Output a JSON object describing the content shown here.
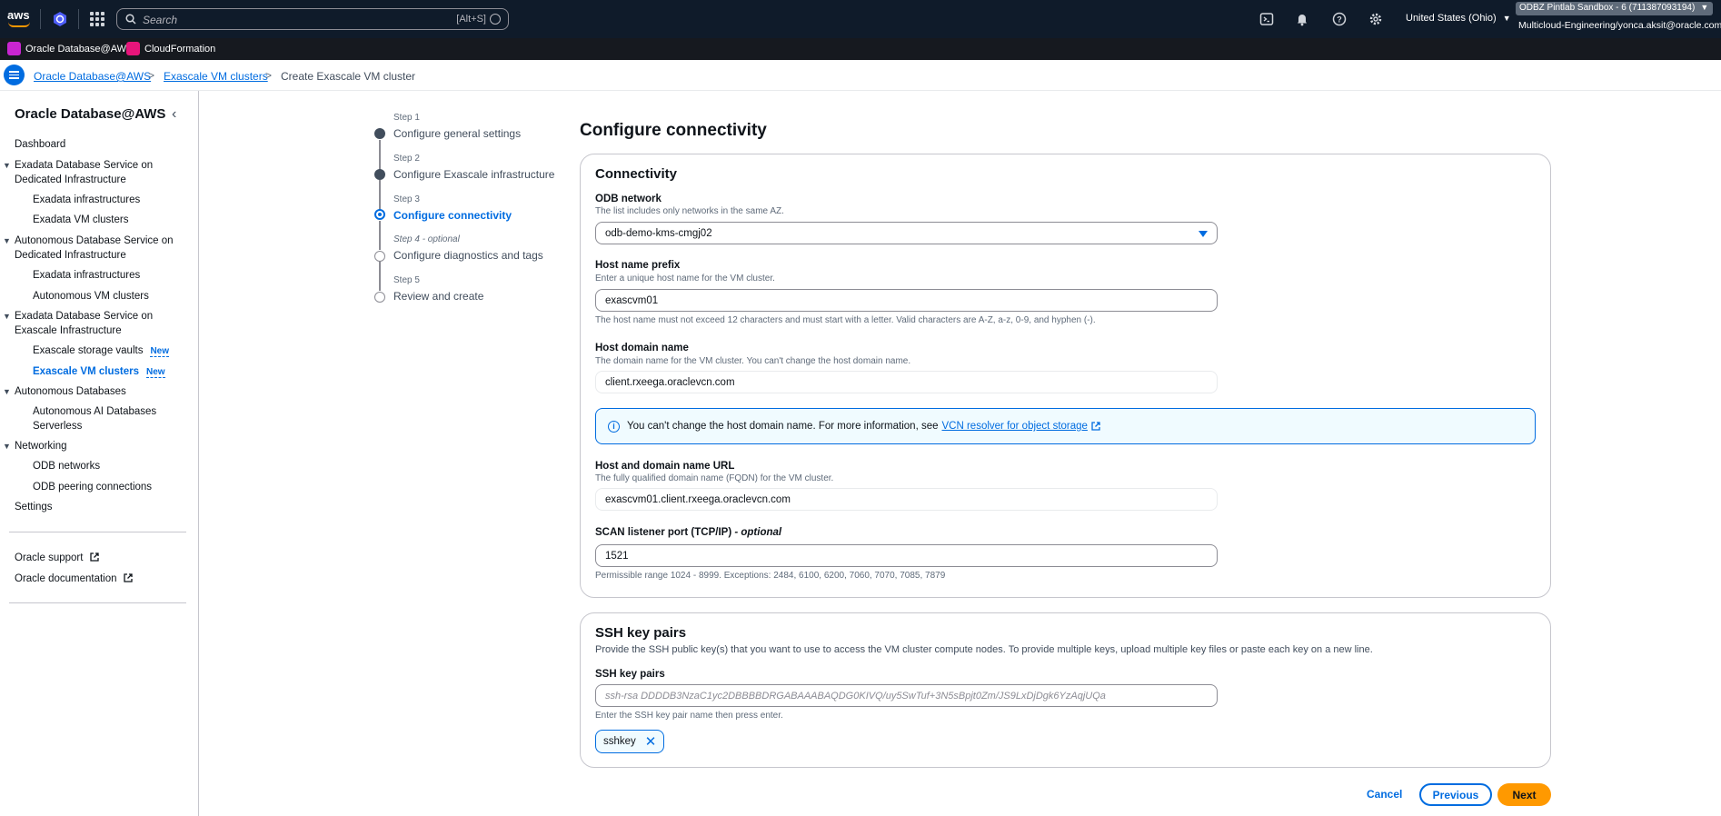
{
  "topnav": {
    "logo_text": "aws",
    "search_placeholder": "Search",
    "search_shortcut": "[Alt+S]",
    "region": "United States (Ohio)",
    "region_caret": "▼",
    "account_name": "ODBZ Pintlab Sandbox - 6 (711387093194)",
    "account_caret": "▼",
    "account_user": "Multicloud-Engineering/yonca.aksit@oracle.com"
  },
  "favorites": [
    {
      "label": "Oracle Database@AWS",
      "color": "#c925d1"
    },
    {
      "label": "CloudFormation",
      "color": "#e7157b"
    }
  ],
  "breadcrumb": {
    "items": [
      "Oracle Database@AWS",
      "Exascale VM clusters"
    ],
    "current": "Create Exascale VM cluster",
    "separator": ">"
  },
  "sidebar": {
    "title": "Oracle Database@AWS",
    "collapse_glyph": "‹",
    "dashboard": "Dashboard",
    "section1": "Exadata Database Service on Dedicated Infrastructure",
    "section1_items": [
      "Exadata infrastructures",
      "Exadata VM clusters"
    ],
    "section2": "Autonomous Database Service on Dedicated Infrastructure",
    "section2_items": [
      "Exadata infrastructures",
      "Autonomous VM clusters"
    ],
    "section3": "Exadata Database Service on Exascale Infrastructure",
    "section3_items": [
      "Exascale storage vaults",
      "Exascale VM clusters"
    ],
    "new_badge": "New",
    "section4": "Autonomous Databases",
    "section4_items": [
      "Autonomous AI Databases Serverless"
    ],
    "section5": "Networking",
    "section5_items": [
      "ODB networks",
      "ODB peering connections"
    ],
    "settings": "Settings",
    "support": "Oracle support",
    "documentation": "Oracle documentation"
  },
  "steps": [
    {
      "number": "Step 1",
      "label": "Configure general settings",
      "state": "done"
    },
    {
      "number": "Step 2",
      "label": "Configure Exascale infrastructure",
      "state": "done"
    },
    {
      "number": "Step 3",
      "label": "Configure connectivity",
      "state": "current"
    },
    {
      "number": "Step 4 - optional",
      "label": "Configure diagnostics and tags",
      "state": "future"
    },
    {
      "number": "Step 5",
      "label": "Review and create",
      "state": "future"
    }
  ],
  "page": {
    "heading": "Configure connectivity"
  },
  "connectivity": {
    "title": "Connectivity",
    "odb_network_label": "ODB network",
    "odb_network_desc": "The list includes only networks in the same AZ.",
    "odb_network_value": "odb-demo-kms-cmgj02",
    "host_prefix_label": "Host name prefix",
    "host_prefix_desc": "Enter a unique host name for the VM cluster.",
    "host_prefix_value": "exascvm01",
    "host_prefix_constraint": "The host name must not exceed 12 characters and must start with a letter. Valid characters are A-Z, a-z, 0-9, and hyphen (-).",
    "domain_label": "Host domain name",
    "domain_desc": "The domain name for the VM cluster. You can't change the host domain name.",
    "domain_value": "client.rxeega.oraclevcn.com",
    "alert_text": "You can't change the host domain name. For more information, see",
    "alert_link": "VCN resolver for object storage",
    "fqdn_label": "Host and domain name URL",
    "fqdn_desc": "The fully qualified domain name (FQDN) for the VM cluster.",
    "fqdn_value": "exascvm01.client.rxeega.oraclevcn.com",
    "scan_label": "SCAN listener port (TCP/IP)",
    "scan_optional": "- optional",
    "scan_value": "1521",
    "scan_constraint": "Permissible range 1024 - 8999. Exceptions: 2484, 6100, 6200, 7060, 7070, 7085, 7879"
  },
  "ssh": {
    "title": "SSH key pairs",
    "description": "Provide the SSH public key(s) that you want to use to access the VM cluster compute nodes. To provide multiple keys, upload multiple key files or paste each key on a new line.",
    "field_label": "SSH key pairs",
    "placeholder": "ssh-rsa DDDDB3NzaC1yc2DBBBBDRGABAAABAQDG0KIVQ/uy5SwTuf+3N5sBpjt0Zm/JS9LxDjDgk6YzAqjUQa",
    "constraint": "Enter the SSH key pair name then press enter.",
    "token": "sshkey",
    "token_remove": "✕"
  },
  "footer": {
    "cancel": "Cancel",
    "previous": "Previous",
    "next": "Next"
  },
  "colors": {
    "accent": "#006ce0",
    "primary_button": "#ff9900",
    "nav_background": "#0f1b2a"
  }
}
